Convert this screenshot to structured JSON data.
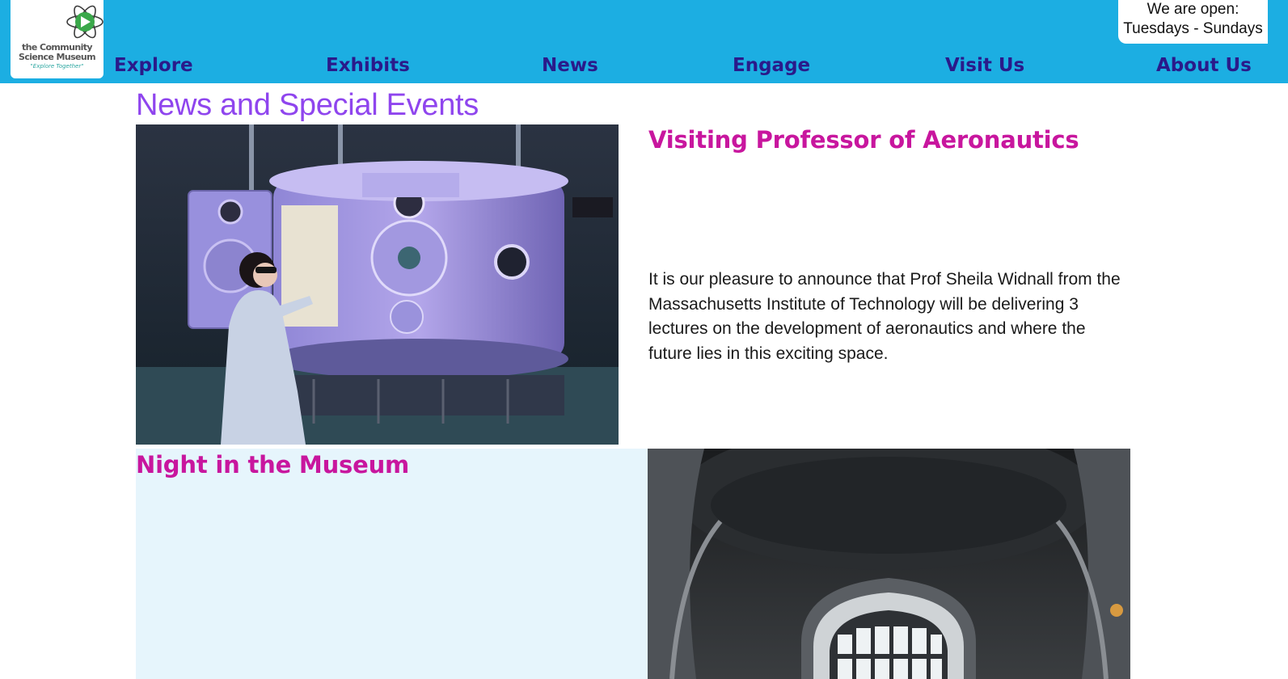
{
  "logo": {
    "line1": "the Community",
    "line2": "Science Museum",
    "tagline": "\"Explore Together\""
  },
  "hours": {
    "line1": "We are open:",
    "line2": "Tuesdays - Sundays"
  },
  "nav": {
    "items": [
      {
        "label": "Explore"
      },
      {
        "label": "Exhibits"
      },
      {
        "label": "News"
      },
      {
        "label": "Engage"
      },
      {
        "label": "Visit Us"
      },
      {
        "label": "About Us"
      }
    ]
  },
  "page": {
    "title": "News and Special Events"
  },
  "stories": [
    {
      "title": "Visiting Professor of Aeronautics",
      "body": "It is our pleasure to announce that Prof Sheila Widnall from the Massachusetts Institute of Technology will be delivering 3 lectures on the development of aeronautics and where the future lies in this exciting space."
    },
    {
      "title": "Night in the Museum"
    }
  ],
  "colors": {
    "header_bg": "#1caee2",
    "nav_text": "#2a1a8a",
    "page_title": "#8f45ee",
    "story_title": "#c8169e",
    "panel_bg": "#e6f5fc"
  }
}
